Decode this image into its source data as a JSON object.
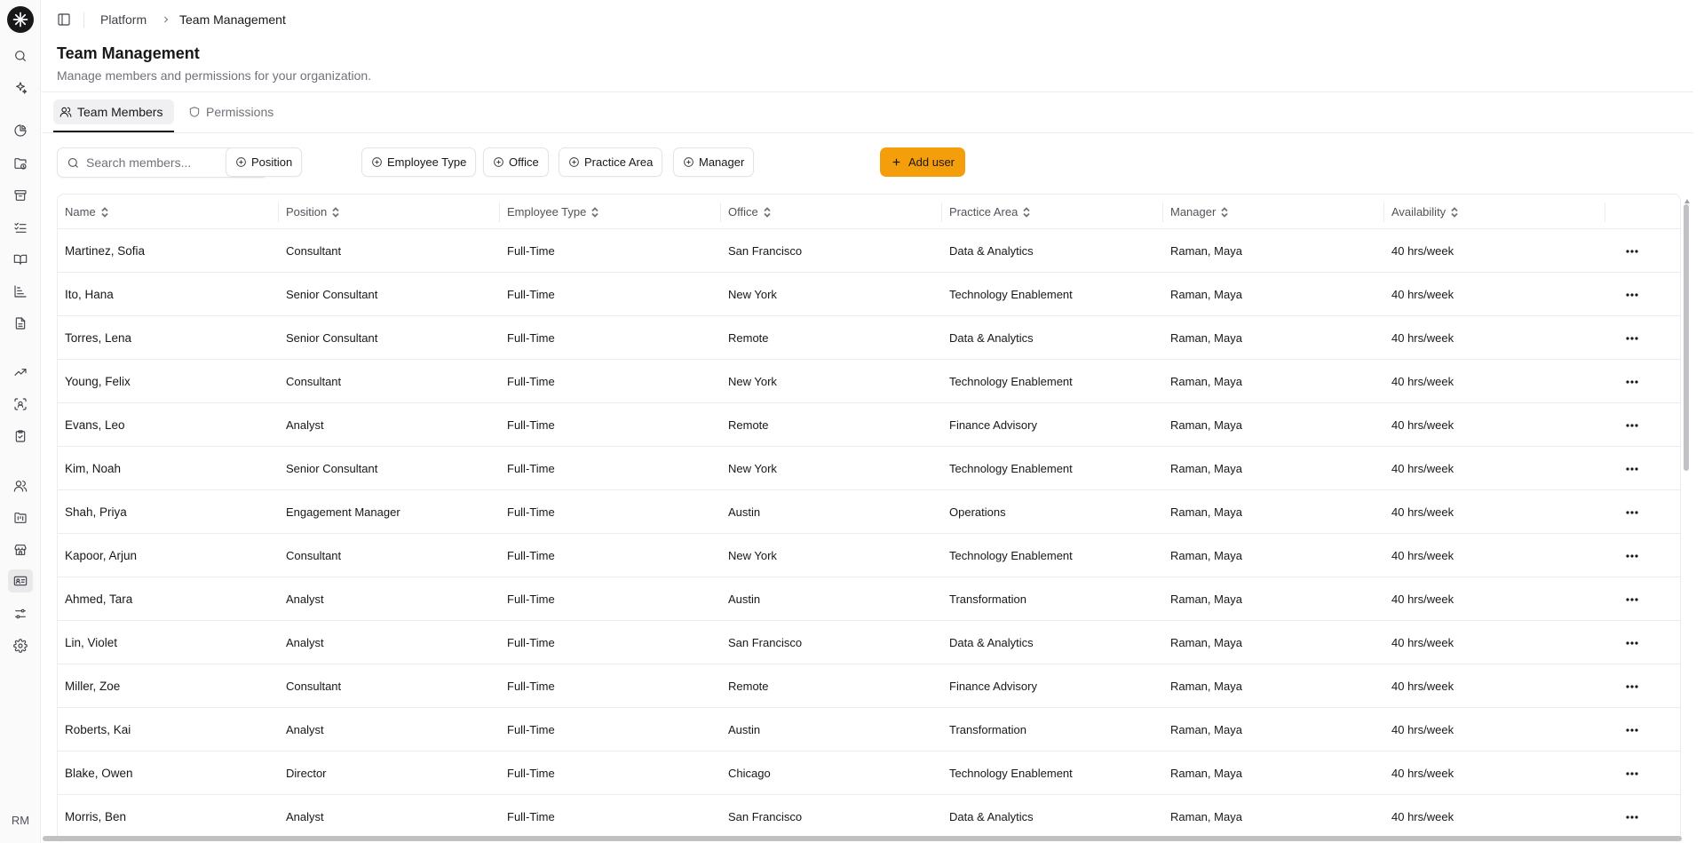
{
  "breadcrumb": {
    "root": "Platform",
    "current": "Team Management"
  },
  "page": {
    "title": "Team Management",
    "subtitle": "Manage members and permissions for your organization."
  },
  "tabs": [
    {
      "label": "Team Members",
      "icon": "users-icon",
      "active": true
    },
    {
      "label": "Permissions",
      "icon": "shield-icon",
      "active": false
    }
  ],
  "search": {
    "placeholder": "Search members...",
    "value": ""
  },
  "filters": [
    "Position",
    "Employee Type",
    "Office",
    "Practice Area",
    "Manager"
  ],
  "add_user_label": "Add user",
  "colors": {
    "accent": "#f59e0b",
    "text": "#18181b",
    "muted": "#71717a",
    "border": "#ececee"
  },
  "user": {
    "initials": "RM"
  },
  "table": {
    "columns": [
      "Name",
      "Position",
      "Employee Type",
      "Office",
      "Practice Area",
      "Manager",
      "Availability"
    ],
    "rows": [
      [
        "Martinez, Sofia",
        "Consultant",
        "Full-Time",
        "San Francisco",
        "Data & Analytics",
        "Raman, Maya",
        "40 hrs/week"
      ],
      [
        "Ito, Hana",
        "Senior Consultant",
        "Full-Time",
        "New York",
        "Technology Enablement",
        "Raman, Maya",
        "40 hrs/week"
      ],
      [
        "Torres, Lena",
        "Senior Consultant",
        "Full-Time",
        "Remote",
        "Data & Analytics",
        "Raman, Maya",
        "40 hrs/week"
      ],
      [
        "Young, Felix",
        "Consultant",
        "Full-Time",
        "New York",
        "Technology Enablement",
        "Raman, Maya",
        "40 hrs/week"
      ],
      [
        "Evans, Leo",
        "Analyst",
        "Full-Time",
        "Remote",
        "Finance Advisory",
        "Raman, Maya",
        "40 hrs/week"
      ],
      [
        "Kim, Noah",
        "Senior Consultant",
        "Full-Time",
        "New York",
        "Technology Enablement",
        "Raman, Maya",
        "40 hrs/week"
      ],
      [
        "Shah, Priya",
        "Engagement Manager",
        "Full-Time",
        "Austin",
        "Operations",
        "Raman, Maya",
        "40 hrs/week"
      ],
      [
        "Kapoor, Arjun",
        "Consultant",
        "Full-Time",
        "New York",
        "Technology Enablement",
        "Raman, Maya",
        "40 hrs/week"
      ],
      [
        "Ahmed, Tara",
        "Analyst",
        "Full-Time",
        "Austin",
        "Transformation",
        "Raman, Maya",
        "40 hrs/week"
      ],
      [
        "Lin, Violet",
        "Analyst",
        "Full-Time",
        "San Francisco",
        "Data & Analytics",
        "Raman, Maya",
        "40 hrs/week"
      ],
      [
        "Miller, Zoe",
        "Consultant",
        "Full-Time",
        "Remote",
        "Finance Advisory",
        "Raman, Maya",
        "40 hrs/week"
      ],
      [
        "Roberts, Kai",
        "Analyst",
        "Full-Time",
        "Austin",
        "Transformation",
        "Raman, Maya",
        "40 hrs/week"
      ],
      [
        "Blake, Owen",
        "Director",
        "Full-Time",
        "Chicago",
        "Technology Enablement",
        "Raman, Maya",
        "40 hrs/week"
      ],
      [
        "Morris, Ben",
        "Analyst",
        "Full-Time",
        "San Francisco",
        "Data & Analytics",
        "Raman, Maya",
        "40 hrs/week"
      ]
    ]
  }
}
